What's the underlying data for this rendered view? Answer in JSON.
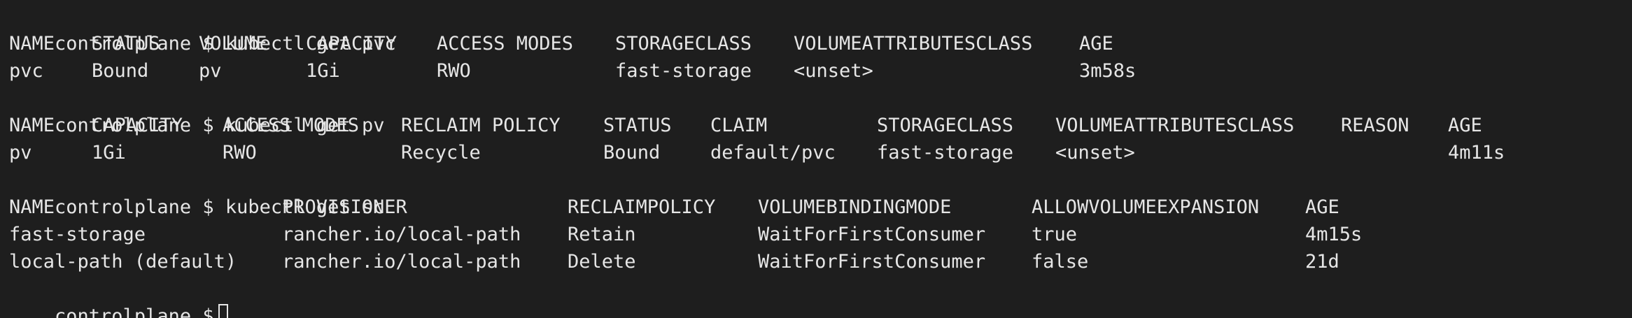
{
  "terminal": {
    "prompt": "controlplane $",
    "pvc": {
      "command": "kubectl get pvc",
      "headers": [
        "NAME",
        "STATUS",
        "VOLUME",
        "CAPACITY",
        "ACCESS MODES",
        "STORAGECLASS",
        "VOLUMEATTRIBUTESCLASS",
        "AGE"
      ],
      "rows": [
        [
          "pvc",
          "Bound",
          "pv",
          "1Gi",
          "RWO",
          "fast-storage",
          "<unset>",
          "3m58s"
        ]
      ]
    },
    "pv": {
      "command": "kubectl get pv",
      "headers": [
        "NAME",
        "CAPACITY",
        "ACCESS MODES",
        "RECLAIM POLICY",
        "STATUS",
        "CLAIM",
        "STORAGECLASS",
        "VOLUMEATTRIBUTESCLASS",
        "REASON",
        "AGE"
      ],
      "rows": [
        [
          "pv",
          "1Gi",
          "RWO",
          "Recycle",
          "Bound",
          "default/pvc",
          "fast-storage",
          "<unset>",
          "",
          "4m11s"
        ]
      ]
    },
    "sc": {
      "command": "kubectl get sc",
      "headers": [
        "NAME",
        "PROVISIONER",
        "RECLAIMPOLICY",
        "VOLUMEBINDINGMODE",
        "ALLOWVOLUMEEXPANSION",
        "AGE"
      ],
      "rows": [
        [
          "fast-storage",
          "rancher.io/local-path",
          "Retain",
          "WaitForFirstConsumer",
          "true",
          "4m15s"
        ],
        [
          "local-path (default)",
          "rancher.io/local-path",
          "Delete",
          "WaitForFirstConsumer",
          "false",
          "21d"
        ]
      ]
    }
  }
}
